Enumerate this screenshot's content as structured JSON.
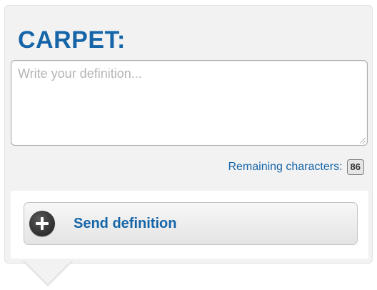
{
  "word": {
    "title": "CARPET:"
  },
  "definition": {
    "placeholder": "Write your definition...",
    "value": ""
  },
  "counter": {
    "label": "Remaining characters:",
    "value": "86"
  },
  "send": {
    "label": "Send definition",
    "icon": "plus-circle-icon"
  },
  "colors": {
    "accent": "#1565a8",
    "card_background": "#f2f2f2"
  }
}
